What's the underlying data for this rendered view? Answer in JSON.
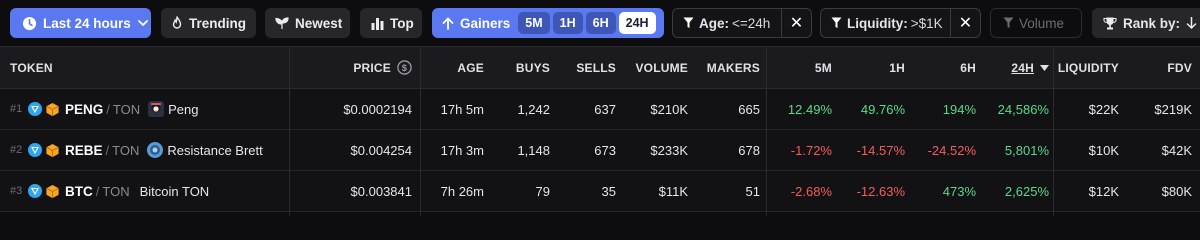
{
  "toolbar": {
    "timeframe_label": "Last 24 hours",
    "trending_label": "Trending",
    "newest_label": "Newest",
    "top_label": "Top",
    "gainers_label": "Gainers",
    "gainers_periods": [
      "5M",
      "1H",
      "6H",
      "24H"
    ],
    "gainers_active": "24H",
    "age_filter": {
      "label": "Age:",
      "value": "<=24h"
    },
    "liquidity_filter": {
      "label": "Liquidity:",
      "value": ">$1K"
    },
    "volume_label": "Volume",
    "rank_label": "Rank by:",
    "colors": {
      "accent": "#5a78f0",
      "positive": "#5cd88a",
      "negative": "#f25c5c"
    }
  },
  "table": {
    "headers": {
      "token": "TOKEN",
      "price": "PRICE",
      "age": "AGE",
      "buys": "BUYS",
      "sells": "SELLS",
      "volume": "VOLUME",
      "makers": "MAKERS",
      "m5": "5M",
      "h1": "1H",
      "h6": "6H",
      "h24": "24H",
      "liquidity": "LIQUIDITY",
      "fdv": "FDV"
    },
    "rows": [
      {
        "rank": "#1",
        "symbol": "PENG",
        "quote": "TON",
        "name": "Peng",
        "price": "$0.0002194",
        "age": "17h 5m",
        "buys": "1,242",
        "sells": "637",
        "volume": "$210K",
        "makers": "665",
        "m5": "12.49%",
        "h1": "49.76%",
        "h6": "194%",
        "h24": "24,586%",
        "liquidity": "$22K",
        "fdv": "$219K"
      },
      {
        "rank": "#2",
        "symbol": "REBE",
        "quote": "TON",
        "name": "Resistance Brett",
        "price": "$0.004254",
        "age": "17h 3m",
        "buys": "1,148",
        "sells": "673",
        "volume": "$233K",
        "makers": "678",
        "m5": "-1.72%",
        "h1": "-14.57%",
        "h6": "-24.52%",
        "h24": "5,801%",
        "liquidity": "$10K",
        "fdv": "$42K"
      },
      {
        "rank": "#3",
        "symbol": "BTC",
        "quote": "TON",
        "name": "Bitcoin TON",
        "price": "$0.003841",
        "age": "7h 26m",
        "buys": "79",
        "sells": "35",
        "volume": "$11K",
        "makers": "51",
        "m5": "-2.68%",
        "h1": "-12.63%",
        "h6": "473%",
        "h24": "2,625%",
        "liquidity": "$12K",
        "fdv": "$80K"
      }
    ]
  }
}
